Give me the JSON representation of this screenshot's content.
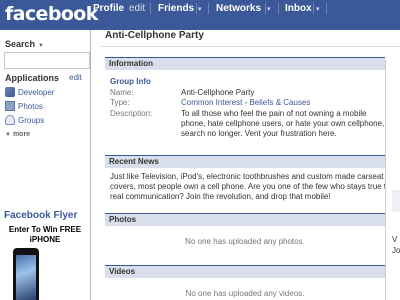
{
  "topbar": {
    "logo": "facebook",
    "nav": {
      "profile": "Profile",
      "edit": "edit",
      "friends": "Friends",
      "networks": "Networks",
      "inbox": "Inbox",
      "caret": "▾"
    }
  },
  "sidebar": {
    "search_label": "Search",
    "search_placeholder": "",
    "applications_label": "Applications",
    "applications_edit": "edit",
    "apps": [
      {
        "label": "Developer",
        "icon": "developer-icon"
      },
      {
        "label": "Photos",
        "icon": "photos-icon"
      },
      {
        "label": "Groups",
        "icon": "groups-icon"
      }
    ],
    "more_label": "more",
    "flyer": {
      "title": "Facebook Flyer",
      "line1": "Enter To Win FREE",
      "line2": "iPHONE"
    }
  },
  "group": {
    "title": "Anti-Cellphone Party",
    "information_header": "Information",
    "info_subheader": "Group Info",
    "fields": {
      "name_label": "Name:",
      "name_value": "Anti-Cellphone Party",
      "type_label": "Type:",
      "type_value_1": "Common Interest",
      "type_sep": " - ",
      "type_value_2": "Beliefs & Causes",
      "description_label": "Description:",
      "description_value": "To all those who feel the pain of not owning a mobile phone, hate cellphone users, or hate your own cellphone, search no longer. Vent your frustration here."
    },
    "recent_news_header": "Recent News",
    "recent_news_text": "Just like Television, iPod's, electronic toothbrushes and custom made carseat covers, most people own a cell phone. Are you one of the few who stays true to real communication? Join the revolution, and drop that mobile!",
    "photos_header": "Photos",
    "photos_empty": "No one has uploaded any photos.",
    "videos_header": "Videos",
    "videos_empty": "No one has uploaded any videos."
  },
  "right_strip": {
    "text_1": "V",
    "text_2": "Jo"
  }
}
